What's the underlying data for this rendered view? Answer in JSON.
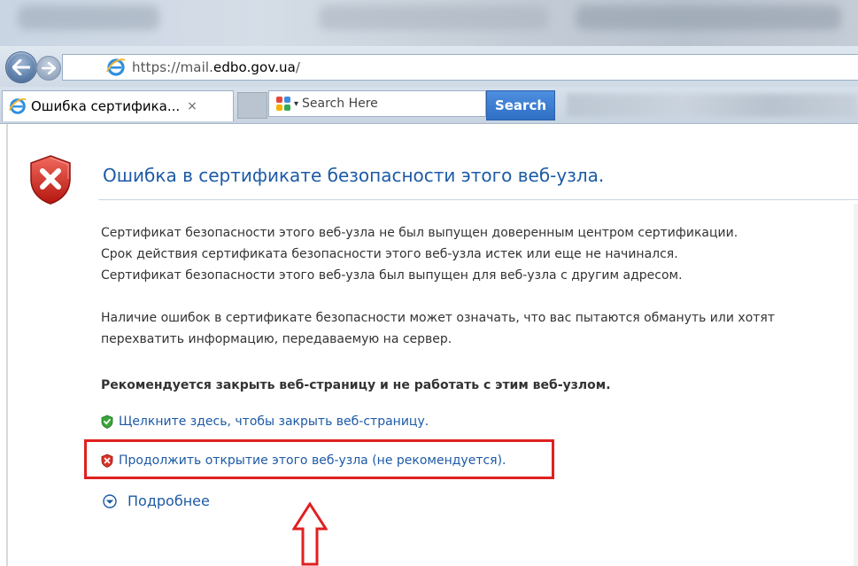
{
  "browser": {
    "address": {
      "prefix": "https://mail.",
      "domain": "edbo.gov.ua",
      "suffix": "/"
    },
    "tab": {
      "title": "Ошибка сертифика...",
      "close_glyph": "×"
    },
    "search": {
      "placeholder": "Search Here",
      "button_label": "Search",
      "caret_glyph": "▾"
    }
  },
  "page": {
    "title": "Ошибка в сертификате безопасности этого веб-узла.",
    "reasons": [
      "Сертификат безопасности этого веб-узла не был выпущен доверенным центром сертификации.",
      "Срок действия сертификата безопасности этого веб-узла истек или еще не начинался.",
      "Сертификат безопасности этого веб-узла был выпущен для веб-узла с другим адресом."
    ],
    "warning": [
      "Наличие ошибок в сертификате безопасности может означать, что вас пытаются обмануть или хотят",
      "перехватить информацию, передаваемую на сервер."
    ],
    "recommendation": "Рекомендуется закрыть веб-страницу и не работать с этим веб-узлом.",
    "close_link": "Щелкните здесь, чтобы закрыть веб-страницу.",
    "continue_link": "Продолжить открытие этого веб-узла (не рекомендуется).",
    "more_info": "Подробнее"
  },
  "icons": {
    "back": "back-arrow-icon",
    "forward": "forward-arrow-icon",
    "browser": "internet-explorer-icon",
    "search_provider": "search-provider-icon",
    "shield_error": "shield-error-icon",
    "shield_ok": "shield-check-icon",
    "expand": "chevron-down-circle-icon",
    "annotation_arrow": "up-arrow-annotation-icon"
  },
  "colors": {
    "link": "#1c5aa6",
    "highlight": "#e02020",
    "search_button": "#2f6fc4"
  }
}
